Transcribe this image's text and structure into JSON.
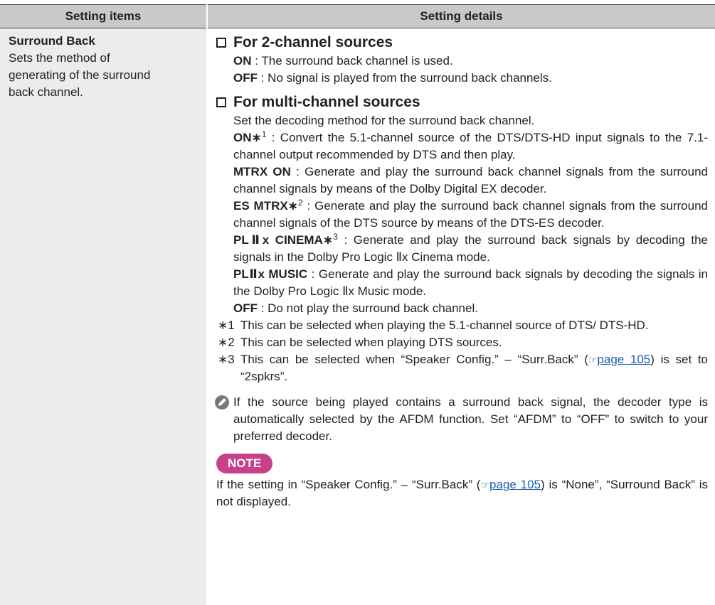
{
  "header": {
    "col1": "Setting items",
    "col2": "Setting details"
  },
  "left": {
    "title": "Surround Back",
    "desc1": "Sets the method of",
    "desc2": "generating of the surround",
    "desc3": "back channel."
  },
  "s1": {
    "heading": "For 2-channel sources",
    "on_label": "ON",
    "on_text": " : The surround back channel is used.",
    "off_label": "OFF",
    "off_text": " : No signal is played from the surround back channels."
  },
  "s2": {
    "heading": "For multi-channel sources",
    "intro": "Set the decoding method for the surround back channel.",
    "on_label": "ON",
    "on_mark": "∗",
    "on_sup": "1",
    "on_text": " : Convert the 5.1-channel source of the DTS/DTS-HD input signals to the 7.1-channel output recommended by DTS and then play.",
    "mtrx_label": "MTRX ON",
    "mtrx_text": " : Generate and play the surround back channel signals from the surround channel signals by means of the Dolby Digital EX decoder.",
    "es_label": "ES MTRX",
    "es_mark": "∗",
    "es_sup": "2",
    "es_text": " : Generate and play the surround back channel signals from the surround channel signals of the DTS source by means of the DTS-ES decoder.",
    "plc_label": "PLⅡx CINEMA",
    "plc_mark": "∗",
    "plc_sup": "3",
    "plc_text": " : Generate and play the surround back signals by decoding the signals in the Dolby Pro Logic Ⅱx Cinema mode.",
    "plm_label": "PLⅡx MUSIC",
    "plm_text": " : Generate and play the surround back signals by decoding the signals in the Dolby Pro Logic Ⅱx Music mode.",
    "off_label": "OFF",
    "off_text": " : Do not play the surround back channel."
  },
  "footnotes": [
    {
      "mark": "∗1",
      "text": "This can be selected when playing the 5.1-channel source of DTS/ DTS-HD."
    },
    {
      "mark": "∗2",
      "text": "This can be selected when playing DTS sources."
    },
    {
      "mark": "∗3",
      "text_before": "This can be selected when “Speaker Config.” – “Surr.Back” (",
      "link": "page 105",
      "text_after": ") is set to “2spkrs”."
    }
  ],
  "memo": {
    "text": "If the source being played contains a surround back signal, the decoder type is automatically selected by the AFDM function. Set “AFDM” to “OFF” to switch to your preferred decoder."
  },
  "note": {
    "badge": "NOTE",
    "text_before": "If the setting in “Speaker Config.” – “Surr.Back” (",
    "link": "page 105",
    "text_after": ") is “None”, “Surround Back” is not displayed."
  },
  "icons": {
    "memo": "pencil-icon",
    "reference": "reference-page-icon"
  },
  "colors": {
    "header_bg": "#c9c9c9",
    "left_bg": "#ececec",
    "note_badge": "#c8428a",
    "link": "#1a5fb4"
  }
}
